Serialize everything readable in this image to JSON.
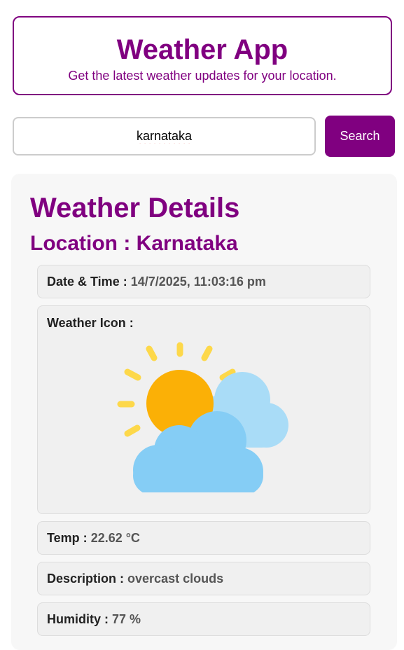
{
  "header": {
    "title": "Weather App",
    "subtitle": "Get the latest weather updates for your location."
  },
  "search": {
    "value": "karnataka",
    "button_label": "Search"
  },
  "details": {
    "title": "Weather Details",
    "location_text": "Location : Karnataka",
    "datetime_label": "Date & Time :",
    "datetime_value": "14/7/2025, 11:03:16 pm",
    "icon_label": "Weather Icon :",
    "icon_name": "sun-behind-clouds-icon",
    "temp_label": "Temp :",
    "temp_value": "22.62 °C",
    "description_label": "Description :",
    "description_value": "overcast clouds",
    "humidity_label": "Humidity :",
    "humidity_value": "77 %"
  },
  "colors": {
    "accent": "#800080",
    "card_bg": "#f7f7f7",
    "row_bg": "#f0f0f0",
    "sun": "#fbb006",
    "sun_rays": "#fdd84a",
    "cloud_back": "#a9dcf7",
    "cloud_front": "#85cdf5"
  }
}
